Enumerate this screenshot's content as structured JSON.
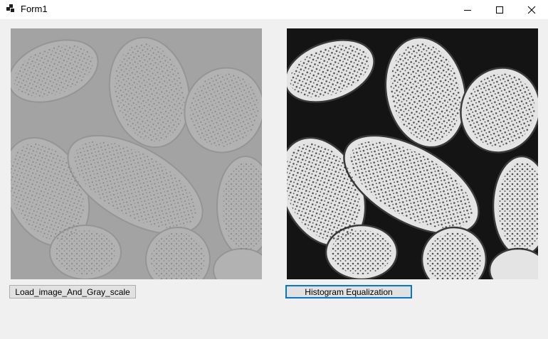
{
  "window": {
    "title": "Form1",
    "icon": "winforms-app-icon",
    "controls": [
      "minimize-icon",
      "maximize-icon",
      "close-icon"
    ]
  },
  "picture_boxes": [
    {
      "name": "original-grayscale",
      "content": "low-contrast grayscale pollen micrograph"
    },
    {
      "name": "equalized",
      "content": "histogram-equalized pollen micrograph"
    }
  ],
  "buttons": {
    "load": "Load_image_And_Gray_scale",
    "equalize": "Histogram Equalization"
  },
  "colors": {
    "window_bg": "#f0f0f0",
    "titlebar_bg": "#ffffff",
    "button_bg": "#e1e1e1",
    "button_border": "#adadad",
    "focus_border": "#0078d7"
  }
}
